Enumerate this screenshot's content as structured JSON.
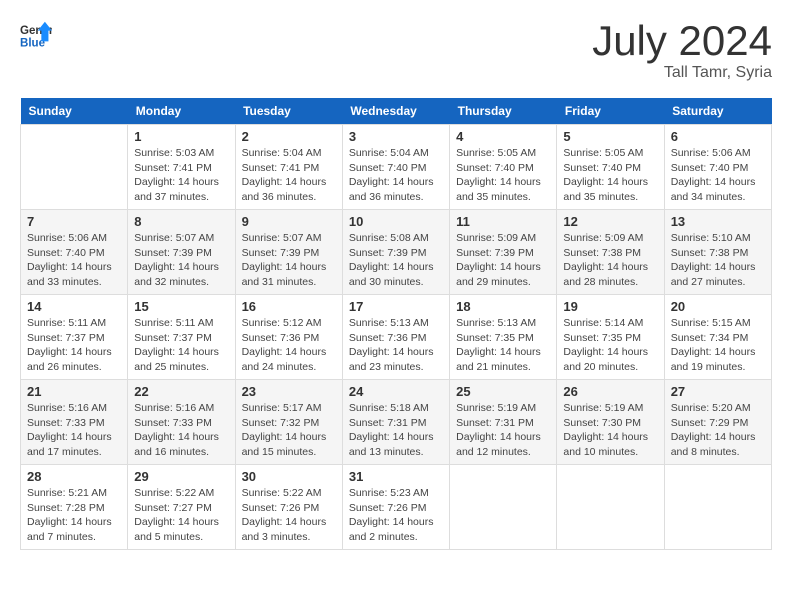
{
  "header": {
    "logo_general": "General",
    "logo_blue": "Blue",
    "title": "July 2024",
    "location": "Tall Tamr, Syria"
  },
  "weekdays": [
    "Sunday",
    "Monday",
    "Tuesday",
    "Wednesday",
    "Thursday",
    "Friday",
    "Saturday"
  ],
  "weeks": [
    [
      {
        "day": null,
        "sunrise": null,
        "sunset": null,
        "daylight": null
      },
      {
        "day": "1",
        "sunrise": "Sunrise: 5:03 AM",
        "sunset": "Sunset: 7:41 PM",
        "daylight": "Daylight: 14 hours and 37 minutes."
      },
      {
        "day": "2",
        "sunrise": "Sunrise: 5:04 AM",
        "sunset": "Sunset: 7:41 PM",
        "daylight": "Daylight: 14 hours and 36 minutes."
      },
      {
        "day": "3",
        "sunrise": "Sunrise: 5:04 AM",
        "sunset": "Sunset: 7:40 PM",
        "daylight": "Daylight: 14 hours and 36 minutes."
      },
      {
        "day": "4",
        "sunrise": "Sunrise: 5:05 AM",
        "sunset": "Sunset: 7:40 PM",
        "daylight": "Daylight: 14 hours and 35 minutes."
      },
      {
        "day": "5",
        "sunrise": "Sunrise: 5:05 AM",
        "sunset": "Sunset: 7:40 PM",
        "daylight": "Daylight: 14 hours and 35 minutes."
      },
      {
        "day": "6",
        "sunrise": "Sunrise: 5:06 AM",
        "sunset": "Sunset: 7:40 PM",
        "daylight": "Daylight: 14 hours and 34 minutes."
      }
    ],
    [
      {
        "day": "7",
        "sunrise": "Sunrise: 5:06 AM",
        "sunset": "Sunset: 7:40 PM",
        "daylight": "Daylight: 14 hours and 33 minutes."
      },
      {
        "day": "8",
        "sunrise": "Sunrise: 5:07 AM",
        "sunset": "Sunset: 7:39 PM",
        "daylight": "Daylight: 14 hours and 32 minutes."
      },
      {
        "day": "9",
        "sunrise": "Sunrise: 5:07 AM",
        "sunset": "Sunset: 7:39 PM",
        "daylight": "Daylight: 14 hours and 31 minutes."
      },
      {
        "day": "10",
        "sunrise": "Sunrise: 5:08 AM",
        "sunset": "Sunset: 7:39 PM",
        "daylight": "Daylight: 14 hours and 30 minutes."
      },
      {
        "day": "11",
        "sunrise": "Sunrise: 5:09 AM",
        "sunset": "Sunset: 7:39 PM",
        "daylight": "Daylight: 14 hours and 29 minutes."
      },
      {
        "day": "12",
        "sunrise": "Sunrise: 5:09 AM",
        "sunset": "Sunset: 7:38 PM",
        "daylight": "Daylight: 14 hours and 28 minutes."
      },
      {
        "day": "13",
        "sunrise": "Sunrise: 5:10 AM",
        "sunset": "Sunset: 7:38 PM",
        "daylight": "Daylight: 14 hours and 27 minutes."
      }
    ],
    [
      {
        "day": "14",
        "sunrise": "Sunrise: 5:11 AM",
        "sunset": "Sunset: 7:37 PM",
        "daylight": "Daylight: 14 hours and 26 minutes."
      },
      {
        "day": "15",
        "sunrise": "Sunrise: 5:11 AM",
        "sunset": "Sunset: 7:37 PM",
        "daylight": "Daylight: 14 hours and 25 minutes."
      },
      {
        "day": "16",
        "sunrise": "Sunrise: 5:12 AM",
        "sunset": "Sunset: 7:36 PM",
        "daylight": "Daylight: 14 hours and 24 minutes."
      },
      {
        "day": "17",
        "sunrise": "Sunrise: 5:13 AM",
        "sunset": "Sunset: 7:36 PM",
        "daylight": "Daylight: 14 hours and 23 minutes."
      },
      {
        "day": "18",
        "sunrise": "Sunrise: 5:13 AM",
        "sunset": "Sunset: 7:35 PM",
        "daylight": "Daylight: 14 hours and 21 minutes."
      },
      {
        "day": "19",
        "sunrise": "Sunrise: 5:14 AM",
        "sunset": "Sunset: 7:35 PM",
        "daylight": "Daylight: 14 hours and 20 minutes."
      },
      {
        "day": "20",
        "sunrise": "Sunrise: 5:15 AM",
        "sunset": "Sunset: 7:34 PM",
        "daylight": "Daylight: 14 hours and 19 minutes."
      }
    ],
    [
      {
        "day": "21",
        "sunrise": "Sunrise: 5:16 AM",
        "sunset": "Sunset: 7:33 PM",
        "daylight": "Daylight: 14 hours and 17 minutes."
      },
      {
        "day": "22",
        "sunrise": "Sunrise: 5:16 AM",
        "sunset": "Sunset: 7:33 PM",
        "daylight": "Daylight: 14 hours and 16 minutes."
      },
      {
        "day": "23",
        "sunrise": "Sunrise: 5:17 AM",
        "sunset": "Sunset: 7:32 PM",
        "daylight": "Daylight: 14 hours and 15 minutes."
      },
      {
        "day": "24",
        "sunrise": "Sunrise: 5:18 AM",
        "sunset": "Sunset: 7:31 PM",
        "daylight": "Daylight: 14 hours and 13 minutes."
      },
      {
        "day": "25",
        "sunrise": "Sunrise: 5:19 AM",
        "sunset": "Sunset: 7:31 PM",
        "daylight": "Daylight: 14 hours and 12 minutes."
      },
      {
        "day": "26",
        "sunrise": "Sunrise: 5:19 AM",
        "sunset": "Sunset: 7:30 PM",
        "daylight": "Daylight: 14 hours and 10 minutes."
      },
      {
        "day": "27",
        "sunrise": "Sunrise: 5:20 AM",
        "sunset": "Sunset: 7:29 PM",
        "daylight": "Daylight: 14 hours and 8 minutes."
      }
    ],
    [
      {
        "day": "28",
        "sunrise": "Sunrise: 5:21 AM",
        "sunset": "Sunset: 7:28 PM",
        "daylight": "Daylight: 14 hours and 7 minutes."
      },
      {
        "day": "29",
        "sunrise": "Sunrise: 5:22 AM",
        "sunset": "Sunset: 7:27 PM",
        "daylight": "Daylight: 14 hours and 5 minutes."
      },
      {
        "day": "30",
        "sunrise": "Sunrise: 5:22 AM",
        "sunset": "Sunset: 7:26 PM",
        "daylight": "Daylight: 14 hours and 3 minutes."
      },
      {
        "day": "31",
        "sunrise": "Sunrise: 5:23 AM",
        "sunset": "Sunset: 7:26 PM",
        "daylight": "Daylight: 14 hours and 2 minutes."
      },
      {
        "day": null,
        "sunrise": null,
        "sunset": null,
        "daylight": null
      },
      {
        "day": null,
        "sunrise": null,
        "sunset": null,
        "daylight": null
      },
      {
        "day": null,
        "sunrise": null,
        "sunset": null,
        "daylight": null
      }
    ]
  ]
}
